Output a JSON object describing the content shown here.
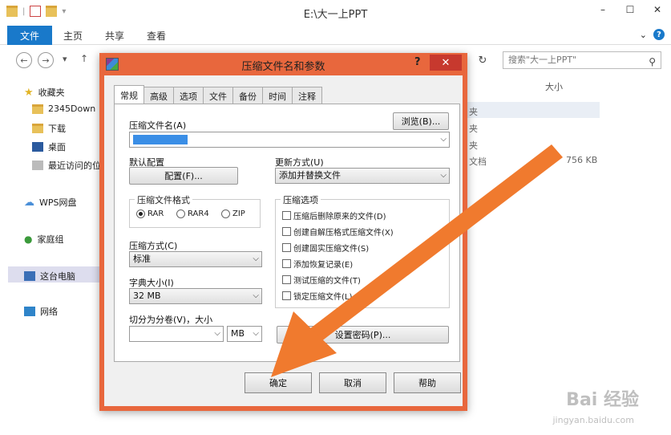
{
  "window": {
    "title": "E:\\大一上PPT",
    "minimize": "–",
    "maximize": "☐",
    "close": "✕"
  },
  "ribbon": {
    "tabs": [
      "文件",
      "主页",
      "共享",
      "查看"
    ]
  },
  "address": {
    "search_placeholder": "搜索\"大一上PPT\"",
    "refresh": "↻"
  },
  "columns": {
    "size": "大小"
  },
  "sidebar": {
    "items": [
      {
        "label": "收藏夹",
        "icon": "star-icon"
      },
      {
        "label": "2345Down",
        "icon": "folder-icon"
      },
      {
        "label": "下载",
        "icon": "download-folder-icon"
      },
      {
        "label": "桌面",
        "icon": "desktop-icon"
      },
      {
        "label": "最近访问的位",
        "icon": "recent-icon"
      },
      {
        "label": "WPS网盘",
        "icon": "cloud-icon"
      },
      {
        "label": "家庭组",
        "icon": "homegroup-icon"
      },
      {
        "label": "这台电脑",
        "icon": "computer-icon"
      },
      {
        "label": "网络",
        "icon": "network-icon"
      }
    ]
  },
  "filelist": {
    "rows": [
      {
        "type": "夹",
        "size": ""
      },
      {
        "type": "夹",
        "size": ""
      },
      {
        "type": "夹",
        "size": ""
      },
      {
        "type": "文档",
        "size": "756 KB"
      }
    ]
  },
  "dialog": {
    "title": "压缩文件名和参数",
    "help": "?",
    "close": "✕",
    "tabs": [
      "常规",
      "高级",
      "选项",
      "文件",
      "备份",
      "时间",
      "注释"
    ],
    "archive_name_label": "压缩文件名(A)",
    "browse_button": "浏览(B)...",
    "default_profile_label": "默认配置",
    "profile_button": "配置(F)...",
    "update_mode_label": "更新方式(U)",
    "update_mode_value": "添加并替换文件",
    "format_group": "压缩文件格式",
    "formats": [
      "RAR",
      "RAR4",
      "ZIP"
    ],
    "selected_format": "RAR",
    "compression_label": "压缩方式(C)",
    "compression_value": "标准",
    "dict_label": "字典大小(I)",
    "dict_value": "32 MB",
    "split_label": "切分为分卷(V)，大小",
    "split_unit": "MB",
    "options_group": "压缩选项",
    "options": [
      "压缩后删除原来的文件(D)",
      "创建自解压格式压缩文件(X)",
      "创建固实压缩文件(S)",
      "添加恢复记录(E)",
      "测试压缩的文件(T)",
      "锁定压缩文件(L)"
    ],
    "password_button": "设置密码(P)...",
    "ok_button": "确定",
    "cancel_button": "取消",
    "help_button": "帮助"
  },
  "watermark": {
    "text": "Bai 经验",
    "sub": "jingyan.baidu.com"
  },
  "colors": {
    "accent": "#1979ca",
    "dialog_frame": "#e8673d",
    "arrow": "#f07a2e"
  }
}
